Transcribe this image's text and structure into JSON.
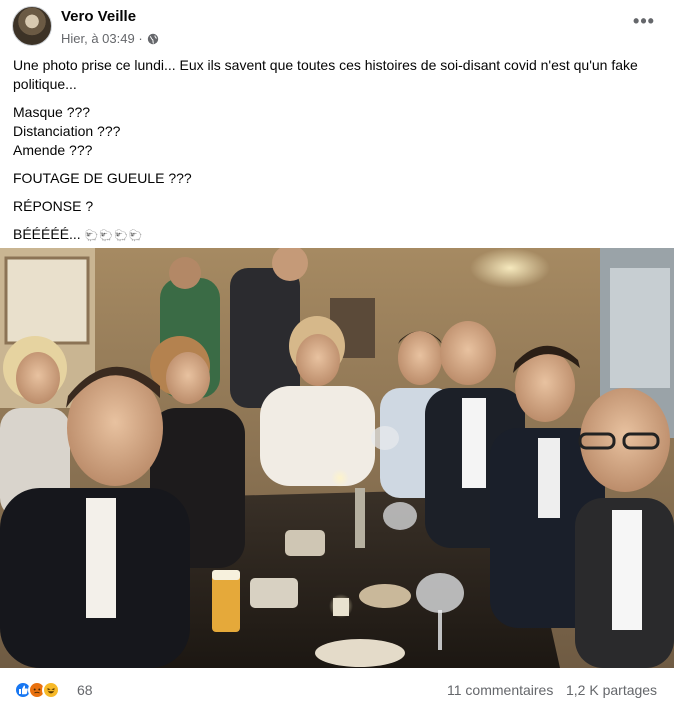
{
  "post": {
    "author": "Vero Veille",
    "timestamp": "Hier, à 03:49 ·",
    "privacy_icon": "globe-icon",
    "more_label": "•••",
    "text": {
      "line1": "Une photo prise ce lundi... Eux ils savent que toutes ces histoires de soi-disant covid n'est qu'un fake politique...",
      "masque": "Masque ???",
      "distanciation": "Distanciation ???",
      "amende": "Amende ???",
      "foutage": "FOUTAGE DE GUEULE ???",
      "reponse": "RÉPONSE ?",
      "beee": "BÉÉÉÉÉ...",
      "sheep_emojis": "🐑🐑🐑🐑"
    }
  },
  "footer": {
    "reactions": [
      "like-icon",
      "angry-icon",
      "haha-icon"
    ],
    "reaction_count": "68",
    "comments": "11 commentaires",
    "shares": "1,2 K partages"
  },
  "colors": {
    "accent": "#1877f2",
    "secondary_text": "#65676b"
  }
}
